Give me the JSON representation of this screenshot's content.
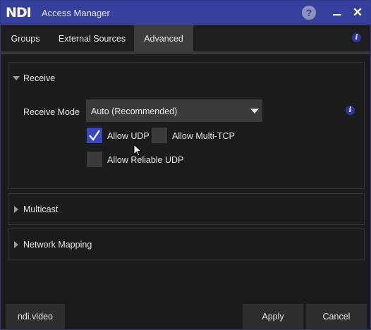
{
  "titlebar": {
    "logo": "NDI",
    "title": "Access Manager",
    "help": "?",
    "close": "✕"
  },
  "tabs": [
    {
      "label": "Groups"
    },
    {
      "label": "External Sources"
    },
    {
      "label": "Advanced"
    }
  ],
  "active_tab": "Advanced",
  "info_glyph": "i",
  "receive": {
    "title": "Receive",
    "mode_label": "Receive Mode",
    "mode_value": "Auto (Recommended)",
    "allow_udp": {
      "label": "Allow UDP",
      "checked": true
    },
    "allow_multi_tcp": {
      "label": "Allow Multi-TCP",
      "checked": false
    },
    "allow_reliable_udp": {
      "label": "Allow Reliable UDP",
      "checked": false
    }
  },
  "multicast": {
    "title": "Multicast"
  },
  "network_mapping": {
    "title": "Network Mapping"
  },
  "footer": {
    "ndi_video": "ndi.video",
    "apply": "Apply",
    "cancel": "Cancel"
  },
  "colors": {
    "titlebar": "#34409b",
    "accent": "#3846c6",
    "info": "#2b37a0"
  }
}
